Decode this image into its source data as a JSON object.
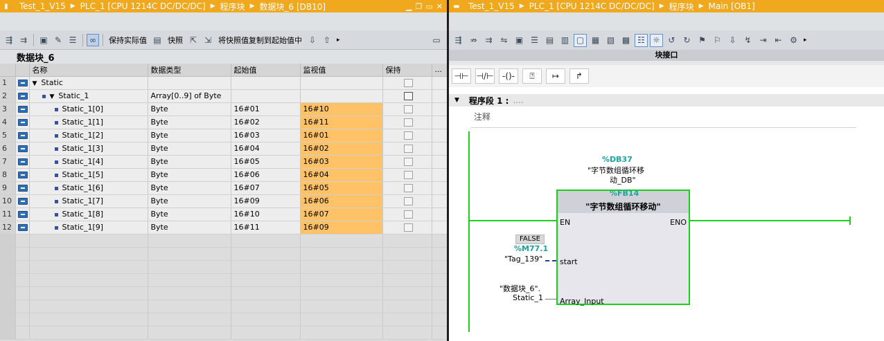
{
  "left": {
    "title_parts": [
      "Test_1_V15",
      "PLC_1 [CPU 1214C DC/DC/DC]",
      "程序块",
      "数据块_6 [DB10]"
    ],
    "toolbar": {
      "keep_actual": "保持实际值",
      "snapshot": "快照",
      "copy_snapshot": "将快照值复制到起始值中"
    },
    "db_name": "数据块_6",
    "columns": [
      "名称",
      "数据类型",
      "起始值",
      "监视值",
      "保持",
      "..."
    ],
    "rows": [
      {
        "n": "1",
        "name": "Static",
        "type": "",
        "start": "",
        "mon": ""
      },
      {
        "n": "2",
        "name": "Static_1",
        "type": "Array[0..9] of Byte",
        "start": "",
        "mon": ""
      },
      {
        "n": "3",
        "name": "Static_1[0]",
        "type": "Byte",
        "start": "16#01",
        "mon": "16#10"
      },
      {
        "n": "4",
        "name": "Static_1[1]",
        "type": "Byte",
        "start": "16#02",
        "mon": "16#11"
      },
      {
        "n": "5",
        "name": "Static_1[2]",
        "type": "Byte",
        "start": "16#03",
        "mon": "16#01"
      },
      {
        "n": "6",
        "name": "Static_1[3]",
        "type": "Byte",
        "start": "16#04",
        "mon": "16#02"
      },
      {
        "n": "7",
        "name": "Static_1[4]",
        "type": "Byte",
        "start": "16#05",
        "mon": "16#03"
      },
      {
        "n": "8",
        "name": "Static_1[5]",
        "type": "Byte",
        "start": "16#06",
        "mon": "16#04"
      },
      {
        "n": "9",
        "name": "Static_1[6]",
        "type": "Byte",
        "start": "16#07",
        "mon": "16#05"
      },
      {
        "n": "10",
        "name": "Static_1[7]",
        "type": "Byte",
        "start": "16#09",
        "mon": "16#06"
      },
      {
        "n": "11",
        "name": "Static_1[8]",
        "type": "Byte",
        "start": "16#10",
        "mon": "16#07"
      },
      {
        "n": "12",
        "name": "Static_1[9]",
        "type": "Byte",
        "start": "16#11",
        "mon": "16#09"
      }
    ]
  },
  "right": {
    "title_parts": [
      "Test_1_V15",
      "PLC_1 [CPU 1214C DC/DC/DC]",
      "程序块",
      "Main [OB1]"
    ],
    "block_interface": "块接口",
    "network": "程序段 1 :",
    "network_dots": "....",
    "comment": "注释",
    "instance_db": "%DB37",
    "instance_name_1": "\"字节数组循环移",
    "instance_name_2": "动_DB\"",
    "fb_number": "%FB14",
    "fb_name": "\"字节数组循环移动\"",
    "pin_en": "EN",
    "pin_eno": "ENO",
    "pin_start": "start",
    "pin_array": "Array_Input",
    "start_value": "FALSE",
    "start_address": "%M77.1",
    "start_tag": "\"Tag_139\"",
    "array_tag_1": "\"数据块_6\".",
    "array_tag_2": "Static_1"
  },
  "colors": {
    "title_orange": "#f0a81e",
    "monitor_highlight": "#ffc266",
    "power_flow_green": "#19d119",
    "address_teal": "#1aa59c"
  }
}
